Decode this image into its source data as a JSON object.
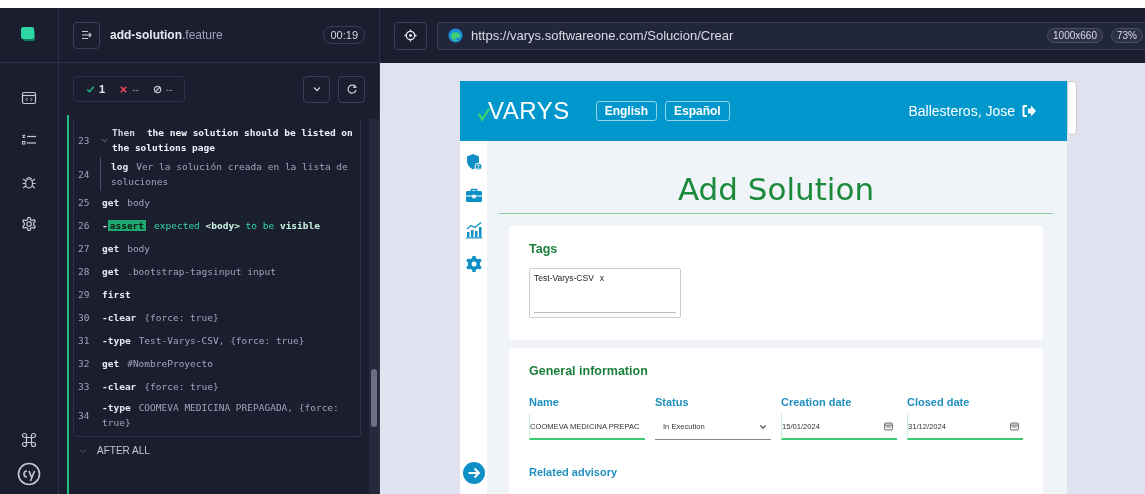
{
  "spec": {
    "file_name": "add-solution",
    "file_ext": ".feature",
    "duration": "00:19"
  },
  "stats": [
    {
      "kind": "passed",
      "count": "1"
    },
    {
      "kind": "failed",
      "count": "--"
    },
    {
      "kind": "pending",
      "count": "--"
    }
  ],
  "code_lines": [
    {
      "number": "23",
      "kind": "step",
      "expanded": true,
      "command": "Then",
      "message": "the new solution should be listed on the solutions page"
    },
    {
      "number": "24",
      "kind": "log",
      "command": "log",
      "message": "Ver la solución creada en la lista de soluciones"
    },
    {
      "number": "25",
      "kind": "command",
      "command": "get",
      "message": "body"
    },
    {
      "number": "26",
      "kind": "assert",
      "prefix": "-",
      "command": "assert",
      "message": "expected **<body>** to be **visible**"
    },
    {
      "number": "27",
      "kind": "command",
      "command": "get",
      "message": "body"
    },
    {
      "number": "28",
      "kind": "command",
      "command": "get",
      "message": ".bootstrap-tagsinput input"
    },
    {
      "number": "29",
      "kind": "command",
      "command": "first"
    },
    {
      "number": "30",
      "kind": "command",
      "prefix": "-",
      "command": "clear",
      "message": "{force: true}"
    },
    {
      "number": "31",
      "kind": "command",
      "prefix": "-",
      "command": "type",
      "message": "Test-Varys-CSV, {force: true}"
    },
    {
      "number": "32",
      "kind": "command",
      "command": "get",
      "message": "#NombreProyecto"
    },
    {
      "number": "33",
      "kind": "command",
      "prefix": "-",
      "command": "clear",
      "message": "{force: true}"
    },
    {
      "number": "34",
      "kind": "command",
      "prefix": "-",
      "command": "type",
      "message": "COOMEVA MEDICINA PREPAGADA, {force: true}"
    }
  ],
  "hook": {
    "label": "AFTER ALL",
    "expanded": false
  },
  "browser": {
    "url": "https://varys.softwareone.com/Solucion/Crear",
    "viewport": "1000x660",
    "zoom": "73%"
  },
  "app": {
    "logo": "VARYS",
    "languages": [
      {
        "label": "English"
      },
      {
        "label": "Español"
      }
    ],
    "user": "Ballesteros, Jose",
    "page_title": "Add Solution",
    "tags_card": {
      "title": "Tags",
      "tags": [
        {
          "label": "Test-Varys-CSV",
          "remove": "x"
        }
      ]
    },
    "general_card": {
      "title": "General information",
      "fields": [
        {
          "kind": "text",
          "label": "Name",
          "value": "COOMEVA MEDICINA PREPAC"
        },
        {
          "kind": "select",
          "label": "Status",
          "value": "In Execution"
        },
        {
          "kind": "date",
          "label": "Creation date",
          "value": "15/01/2024"
        },
        {
          "kind": "date",
          "label": "Closed date",
          "value": "31/12/2024"
        }
      ],
      "next_label": "Related advisory"
    }
  }
}
